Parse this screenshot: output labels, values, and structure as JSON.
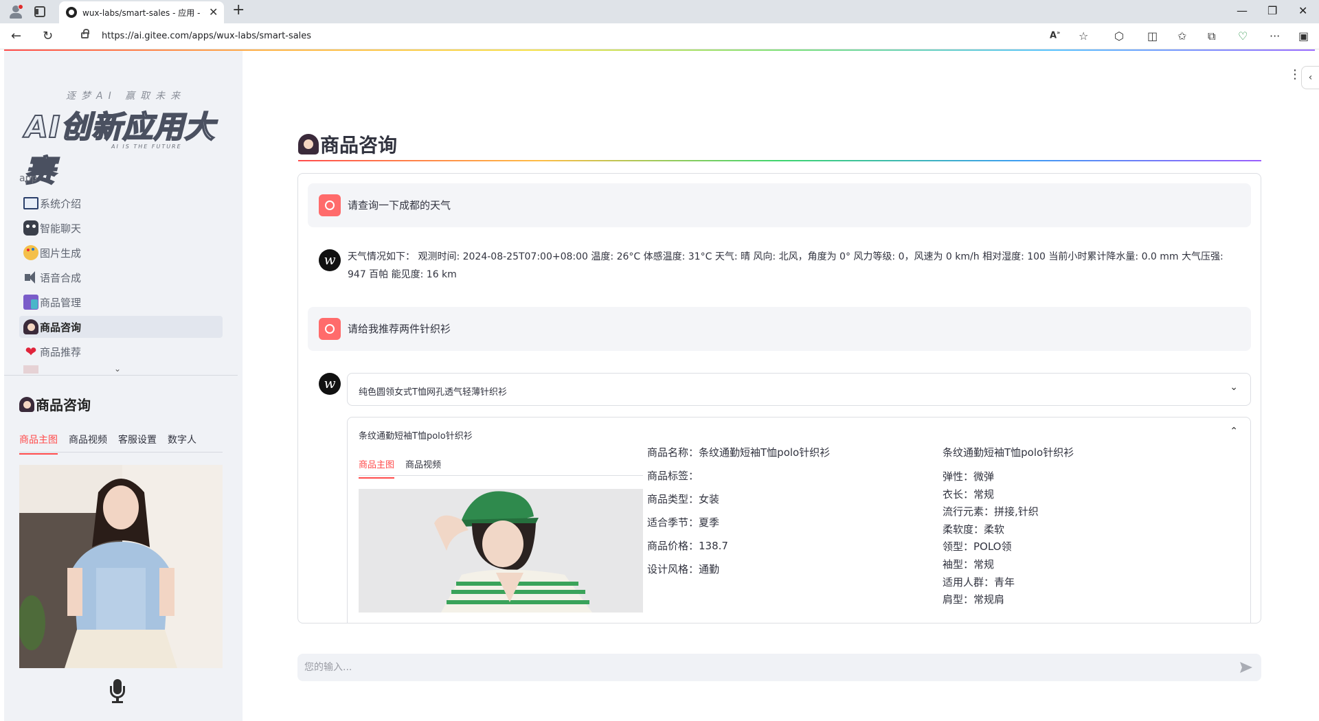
{
  "browser": {
    "tab_title": "wux-labs/smart-sales - 应用 - Gitee",
    "url": "https://ai.gitee.com/apps/wux-labs/smart-sales"
  },
  "sidebar": {
    "logo_tagline": "逐梦AI 赢取未来",
    "logo_title": "AI创新应用大赛",
    "logo_subtitle": "AI IS THE FUTURE",
    "section_label": "app",
    "items": [
      {
        "label": "系统介绍",
        "icon": "book-icon"
      },
      {
        "label": "智能聊天",
        "icon": "robot-icon"
      },
      {
        "label": "图片生成",
        "icon": "palette-icon"
      },
      {
        "label": "语音合成",
        "icon": "speaker-icon"
      },
      {
        "label": "商品管理",
        "icon": "shopping-bags-icon"
      },
      {
        "label": "商品咨询",
        "icon": "woman-raising-hand-icon"
      },
      {
        "label": "商品推荐",
        "icon": "heart-icon"
      }
    ],
    "active_item": "商品咨询",
    "panel_title": "商品咨询",
    "tabs": [
      "商品主图",
      "商品视频",
      "客服设置",
      "数字人"
    ],
    "active_tab": "商品主图"
  },
  "main": {
    "title": "商品咨询",
    "messages": [
      {
        "role": "user",
        "text": "请查询一下成都的天气"
      },
      {
        "role": "assistant",
        "text": "天气情况如下：  观测时间: 2024-08-25T07:00+08:00 温度: 26°C 体感温度: 31°C 天气: 晴 风向: 北风，角度为 0° 风力等级: 0，风速为 0 km/h 相对湿度: 100 当前小时累计降水量: 0.0 mm 大气压强: 947 百帕 能见度: 16 km"
      },
      {
        "role": "user",
        "text": "请给我推荐两件针织衫"
      }
    ],
    "products": [
      {
        "name": "纯色圆领女式T恤网孔透气轻薄针织衫",
        "expanded": false
      },
      {
        "name": "条纹通勤短袖T恤polo针织衫",
        "expanded": true
      }
    ],
    "detail": {
      "tabs": [
        "商品主图",
        "商品视频"
      ],
      "active_tab": "商品主图",
      "fields": [
        {
          "label": "商品名称：",
          "value": "条纹通勤短袖T恤polo针织衫"
        },
        {
          "label": "商品标签：",
          "value": ""
        },
        {
          "label": "商品类型：",
          "value": "女装"
        },
        {
          "label": "适合季节：",
          "value": "夏季"
        },
        {
          "label": "商品价格：",
          "value": "138.7"
        },
        {
          "label": "设计风格：",
          "value": "通勤"
        }
      ],
      "title_right": "条纹通勤短袖T恤polo针织衫",
      "attributes": [
        "弹性：微弹",
        "衣长：常规",
        "流行元素：拼接,针织",
        "柔软度：柔软",
        "领型：POLO领",
        "袖型：常规",
        "适用人群：青年",
        "肩型：常规肩"
      ]
    },
    "input_placeholder": "您的输入..."
  },
  "colors": {
    "accent": "#ff4b4b",
    "sidebar_bg": "#f0f2f6",
    "user_msg_bg": "#f4f5f8"
  }
}
